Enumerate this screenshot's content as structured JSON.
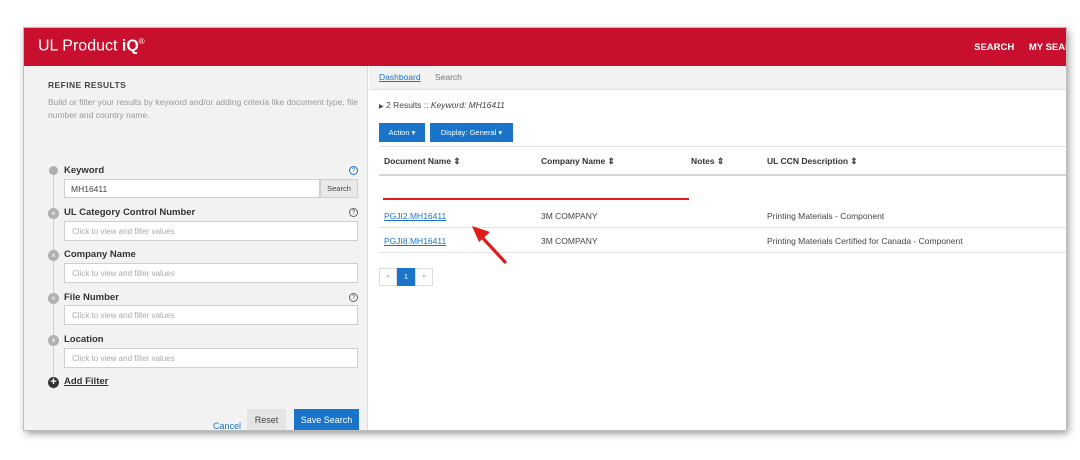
{
  "header": {
    "brand_text": "UL Product ",
    "brand_bold": "iQ",
    "brand_mark": "®",
    "nav": [
      "SEARCH",
      "MY SEAR"
    ]
  },
  "sidebar": {
    "title": "REFINE RESULTS",
    "description": "Build or filter your results by keyword and/or adding criteria like document type, file number and country name.",
    "keyword": {
      "label": "Keyword",
      "value": "MH16411",
      "button": "Search"
    },
    "filters": [
      {
        "label": "UL Category Control Number",
        "placeholder": "Click to view and filter values"
      },
      {
        "label": "Company Name",
        "placeholder": "Click to view and filter values"
      },
      {
        "label": "File Number",
        "placeholder": "Click to view and filter values"
      },
      {
        "label": "Location",
        "placeholder": "Click to view and filter values"
      }
    ],
    "add_filter": "Add Filter",
    "cancel": "Cancel",
    "reset": "Reset",
    "save": "Save Search"
  },
  "breadcrumb": {
    "link": "Dashboard",
    "current": "Search"
  },
  "results": {
    "count": "2 Results :: ",
    "keyword": "Keyword: MH16411"
  },
  "toolbar": {
    "action": "Action ▾",
    "display": "Display: General ▾"
  },
  "table": {
    "columns": [
      "Document Name ⇕",
      "Company Name ⇕",
      "Notes ⇕",
      "UL CCN Description ⇕"
    ],
    "rows": [
      {
        "doc": "PGJI2.MH16411",
        "company": "3M COMPANY",
        "notes": "",
        "desc": "Printing Materials - Component"
      },
      {
        "doc": "PGJI8.MH16411",
        "company": "3M COMPANY",
        "notes": "",
        "desc": "Printing Materials Certified for Canada - Component"
      }
    ]
  },
  "pager": {
    "prev": "«",
    "current": "1",
    "next": "»"
  },
  "colors": {
    "brand_red": "#c8102e",
    "accent_blue": "#1a74c9",
    "annotation_red": "#e01b1b"
  }
}
